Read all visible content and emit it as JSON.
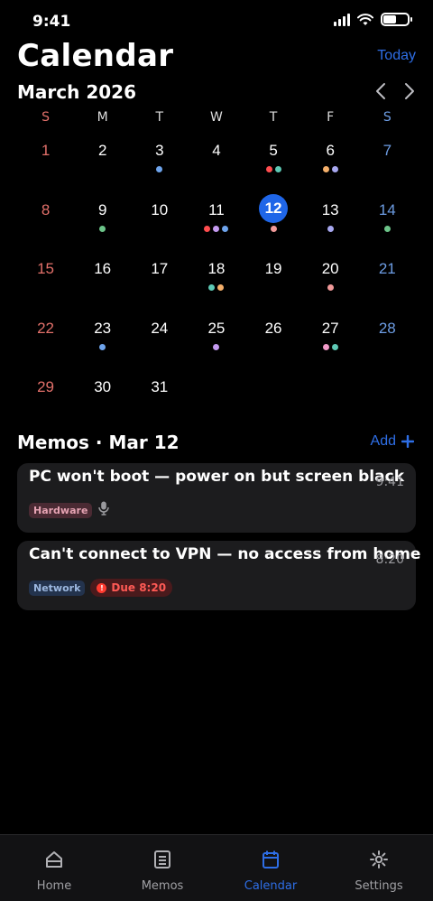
{
  "status": {
    "time": "9:41"
  },
  "header": {
    "title": "Calendar",
    "today_label": "Today"
  },
  "calendar": {
    "month_label": "March 2026",
    "weekdays": [
      "S",
      "M",
      "T",
      "W",
      "T",
      "F",
      "S"
    ],
    "selected_day": "12",
    "weeks": [
      [
        {
          "d": "1",
          "dots": []
        },
        {
          "d": "2",
          "dots": []
        },
        {
          "d": "3",
          "dots": [
            "#6ea4ec"
          ]
        },
        {
          "d": "4",
          "dots": []
        },
        {
          "d": "5",
          "dots": [
            "#ff4d4f",
            "#5ec9b5"
          ]
        },
        {
          "d": "6",
          "dots": [
            "#f5b06b",
            "#a8a8f0"
          ]
        },
        {
          "d": "7",
          "dots": []
        }
      ],
      [
        {
          "d": "8",
          "dots": []
        },
        {
          "d": "9",
          "dots": [
            "#6cc489"
          ]
        },
        {
          "d": "10",
          "dots": []
        },
        {
          "d": "11",
          "dots": [
            "#ff4d4f",
            "#c49af0",
            "#6ea4ec"
          ]
        },
        {
          "d": "12",
          "dots": [
            "#f19a9a"
          ]
        },
        {
          "d": "13",
          "dots": [
            "#a8a8f0"
          ]
        },
        {
          "d": "14",
          "dots": [
            "#6cc489"
          ]
        }
      ],
      [
        {
          "d": "15",
          "dots": []
        },
        {
          "d": "16",
          "dots": []
        },
        {
          "d": "17",
          "dots": []
        },
        {
          "d": "18",
          "dots": [
            "#5ec9b5",
            "#f5b06b"
          ]
        },
        {
          "d": "19",
          "dots": []
        },
        {
          "d": "20",
          "dots": [
            "#f19a9a"
          ]
        },
        {
          "d": "21",
          "dots": []
        }
      ],
      [
        {
          "d": "22",
          "dots": []
        },
        {
          "d": "23",
          "dots": [
            "#6ea4ec"
          ]
        },
        {
          "d": "24",
          "dots": []
        },
        {
          "d": "25",
          "dots": [
            "#c49af0"
          ]
        },
        {
          "d": "26",
          "dots": []
        },
        {
          "d": "27",
          "dots": [
            "#f19ac8",
            "#5ec9b5"
          ]
        },
        {
          "d": "28",
          "dots": []
        }
      ],
      [
        {
          "d": "29",
          "dots": []
        },
        {
          "d": "30",
          "dots": []
        },
        {
          "d": "31",
          "dots": []
        },
        {
          "d": "",
          "dots": []
        },
        {
          "d": "",
          "dots": []
        },
        {
          "d": "",
          "dots": []
        },
        {
          "d": "",
          "dots": []
        }
      ]
    ]
  },
  "memos": {
    "header": "Memos · Mar 12",
    "add_label": "Add",
    "items": [
      {
        "title": "PC won't boot — power on but screen black",
        "time": "9:41",
        "tag": "Hardware",
        "has_voice": true
      },
      {
        "title": "Can't connect to VPN — no access from home",
        "time": "8:20",
        "tag": "Network",
        "due": "Due 8:20"
      }
    ]
  },
  "tabbar": {
    "items": [
      {
        "label": "Home",
        "icon": "home-icon"
      },
      {
        "label": "Memos",
        "icon": "memos-icon"
      },
      {
        "label": "Calendar",
        "icon": "calendar-icon",
        "active": true
      },
      {
        "label": "Settings",
        "icon": "gear-icon"
      }
    ]
  },
  "colors": {
    "accent": "#1f66e8",
    "sunday": "#e2706a",
    "saturday": "#6d9de4",
    "card": "#1c1c1e"
  }
}
